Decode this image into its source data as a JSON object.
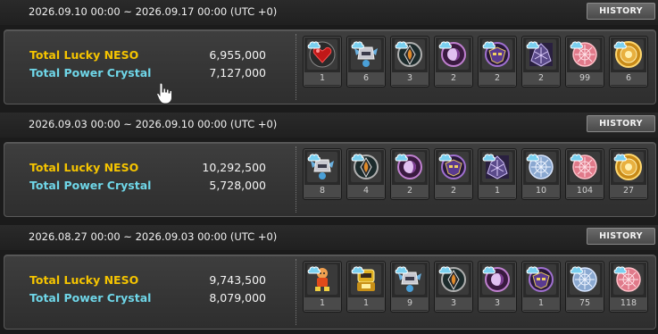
{
  "weeks": [
    {
      "date_range": "2026.09.10 00:00 ~ 2026.09.17 00:00 (UTC +0)",
      "history_label": "HISTORY",
      "lucky_neso_label": "Total Lucky NESO",
      "lucky_neso_value": "6,955,000",
      "power_crystal_label": "Total Power Crystal",
      "power_crystal_value": "7,127,000",
      "items": [
        {
          "icon": "red-heart-orb-icon",
          "count": "1"
        },
        {
          "icon": "winged-helmet-icon",
          "count": "6"
        },
        {
          "icon": "teal-flame-emblem-icon",
          "count": "3"
        },
        {
          "icon": "purple-eye-orb-icon",
          "count": "2"
        },
        {
          "icon": "purple-mask-emblem-icon",
          "count": "2"
        },
        {
          "icon": "dark-crystal-icon",
          "count": "2"
        },
        {
          "icon": "pink-lace-orb-icon",
          "count": "99"
        },
        {
          "icon": "gold-medallion-icon",
          "count": "6"
        }
      ]
    },
    {
      "date_range": "2026.09.03 00:00 ~ 2026.09.10 00:00 (UTC +0)",
      "history_label": "HISTORY",
      "lucky_neso_label": "Total Lucky NESO",
      "lucky_neso_value": "10,292,500",
      "power_crystal_label": "Total Power Crystal",
      "power_crystal_value": "5,728,000",
      "items": [
        {
          "icon": "winged-helmet-icon",
          "count": "8"
        },
        {
          "icon": "teal-flame-emblem-icon",
          "count": "4"
        },
        {
          "icon": "purple-eye-orb-icon",
          "count": "2"
        },
        {
          "icon": "purple-mask-emblem-icon",
          "count": "2"
        },
        {
          "icon": "dark-crystal-icon",
          "count": "1"
        },
        {
          "icon": "blue-lace-orb-icon",
          "count": "10"
        },
        {
          "icon": "pink-lace-orb-icon",
          "count": "104"
        },
        {
          "icon": "gold-medallion-icon",
          "count": "27"
        }
      ]
    },
    {
      "date_range": "2026.08.27 00:00 ~ 2026.09.03 00:00 (UTC +0)",
      "history_label": "HISTORY",
      "lucky_neso_label": "Total Lucky NESO",
      "lucky_neso_value": "9,743,500",
      "power_crystal_label": "Total Power Crystal",
      "power_crystal_value": "8,079,000",
      "items": [
        {
          "icon": "orange-doll-icon",
          "count": "1"
        },
        {
          "icon": "gold-robot-icon",
          "count": "1"
        },
        {
          "icon": "winged-helmet-icon",
          "count": "9"
        },
        {
          "icon": "teal-flame-emblem-icon",
          "count": "3"
        },
        {
          "icon": "purple-eye-orb-icon",
          "count": "3"
        },
        {
          "icon": "purple-mask-emblem-icon",
          "count": "1"
        },
        {
          "icon": "blue-lace-orb-icon",
          "count": "75"
        },
        {
          "icon": "pink-lace-orb-icon",
          "count": "118"
        }
      ]
    }
  ]
}
